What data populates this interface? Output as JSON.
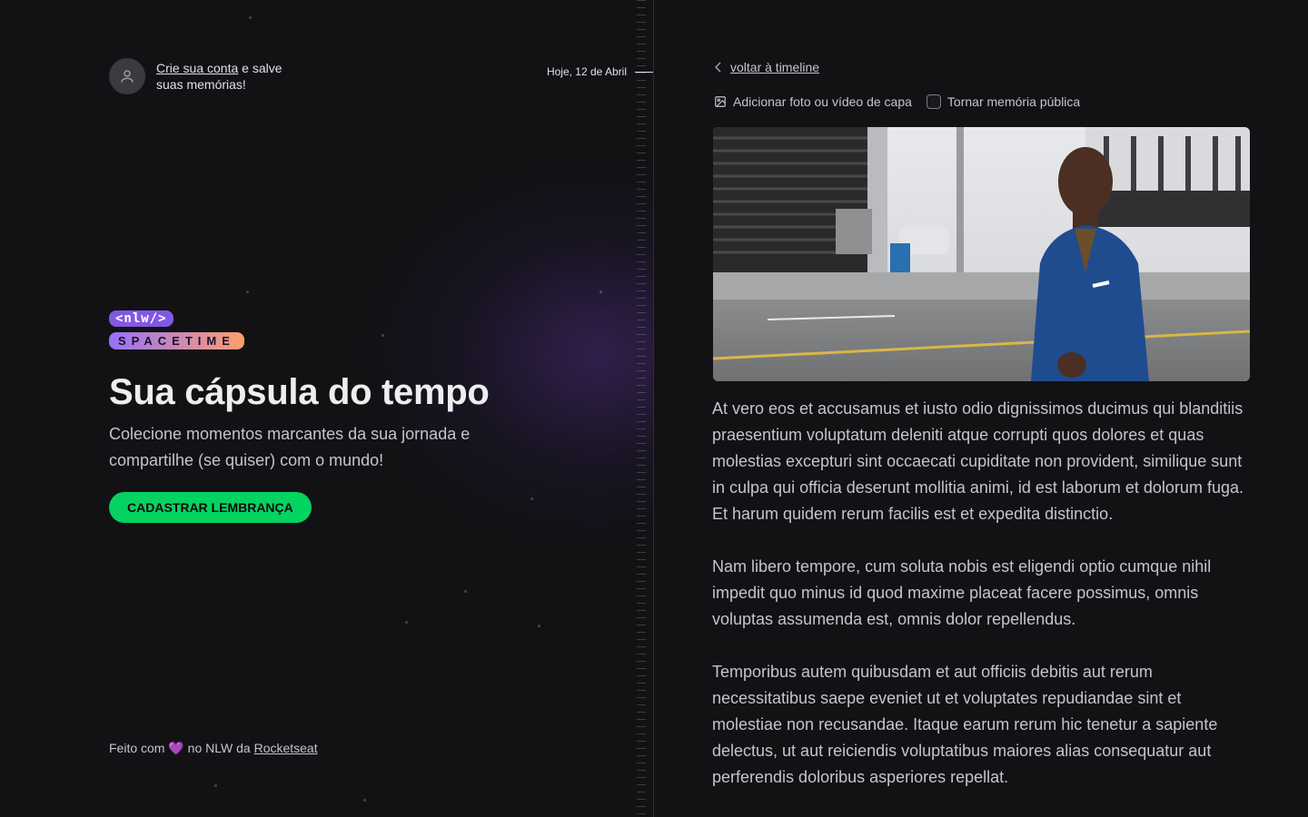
{
  "signin": {
    "link_text": "Crie sua conta",
    "rest_line1": " e salve",
    "rest_line2": "suas memórias!"
  },
  "timeline": {
    "date_label": "Hoje, 12 de Abril"
  },
  "brand": {
    "tag_top": "<nlw/>",
    "tag_bottom": "SPACETIME"
  },
  "hero": {
    "title": "Sua cápsula do tempo",
    "subtitle": "Colecione momentos marcantes da sua jornada e compartilhe (se quiser) com o mundo!",
    "cta_label": "CADASTRAR LEMBRANÇA"
  },
  "footer": {
    "prefix": "Feito com",
    "heart": "💜",
    "middle": " no NLW da ",
    "link": "Rocketseat"
  },
  "memory": {
    "back_label": "voltar à timeline",
    "add_media_label": "Adicionar foto ou vídeo de capa",
    "public_label": "Tornar memória pública",
    "public_checked": false,
    "paragraphs": [
      "At vero eos et accusamus et iusto odio dignissimos ducimus qui blanditiis praesentium voluptatum deleniti atque corrupti quos dolores et quas molestias excepturi sint occaecati cupiditate non provident, similique sunt in culpa qui officia deserunt mollitia animi, id est laborum et dolorum fuga. Et harum quidem rerum facilis est et expedita distinctio.",
      "Nam libero tempore, cum soluta nobis est eligendi optio cumque nihil impedit quo minus id quod maxime placeat facere possimus, omnis voluptas assumenda est, omnis dolor repellendus.",
      "Temporibus autem quibusdam et aut officiis debitis aut rerum necessitatibus saepe eveniet ut et voluptates repudiandae sint et molestiae non recusandae. Itaque earum rerum hic tenetur a sapiente delectus, ut aut reiciendis voluptatibus maiores alias consequatur aut perferendis doloribus asperiores repellat."
    ]
  },
  "colors": {
    "background": "#121215",
    "accent_green": "#04d361",
    "brand_purple": "#8257e5",
    "brand_orange": "#ff9f6b"
  }
}
